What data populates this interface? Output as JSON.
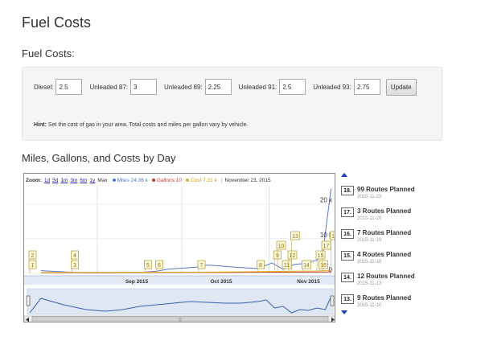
{
  "page": {
    "title": "Fuel Costs",
    "section_title": "Fuel Costs:",
    "chart_title": "Miles, Gallons, and Costs by Day"
  },
  "fuel_prices": {
    "diesel": {
      "label": "Diesel:",
      "value": "2.5"
    },
    "unleaded87": {
      "label": "Unleaded 87:",
      "value": "3"
    },
    "unleaded89": {
      "label": "Unleaded 89:",
      "value": "2.25"
    },
    "unleaded91": {
      "label": "Unleaded 91:",
      "value": "2.5"
    },
    "unleaded93": {
      "label": "Unleaded 93:",
      "value": "2.75"
    },
    "update_label": "Update"
  },
  "hint": {
    "label": "Hint:",
    "text": "Set the cost of gas in your area. Total costs and miles per gallon vary by vehicle."
  },
  "zoom": {
    "label": "Zoom:",
    "buttons": [
      "1d",
      "5d",
      "1m",
      "3m",
      "6m",
      "1y"
    ],
    "max_label": "Max"
  },
  "legend": {
    "miles": "Miles 24.36 k",
    "gallons": "Gallons 10",
    "cost": "Cost 7.31 k",
    "date": "November 23, 2015"
  },
  "colors": {
    "miles": "#5577cc",
    "gallons": "#c0392b",
    "cost": "#e0b020",
    "flag_fill": "#fffbe0",
    "flag_border": "#b8a440",
    "navigator_band": "#dfe7f5",
    "accent": "#1a3ec0"
  },
  "chart_data": {
    "type": "line",
    "x_tick_labels": [
      "Sep 2015",
      "Oct 2015",
      "Nov 2015"
    ],
    "y_tick_labels": [
      "0",
      "10 k",
      "20 k"
    ],
    "ylim": [
      0,
      25000
    ],
    "series": [
      {
        "name": "Miles",
        "x": [
          "2015-08-12",
          "2015-08-16",
          "2015-08-24",
          "2015-08-28",
          "2015-09-05",
          "2015-09-16",
          "2015-09-22",
          "2015-09-26",
          "2015-10-06",
          "2015-10-10",
          "2015-10-14",
          "2015-10-18",
          "2015-10-24",
          "2015-10-28",
          "2015-11-02",
          "2015-11-06",
          "2015-11-10",
          "2015-11-13",
          "2015-11-18",
          "2015-11-20",
          "2015-11-23"
        ],
        "y": [
          800,
          600,
          300,
          200,
          200,
          300,
          600,
          1200,
          1800,
          2400,
          2200,
          1900,
          1600,
          1400,
          3000,
          1200,
          2600,
          2800,
          3800,
          5200,
          24360
        ]
      },
      {
        "name": "Gallons",
        "x": [
          "2015-08-12",
          "2015-10-15",
          "2015-11-23"
        ],
        "y": [
          200,
          300,
          400
        ]
      },
      {
        "name": "Cost",
        "x": [
          "2015-08-12",
          "2015-10-15",
          "2015-11-18",
          "2015-11-23"
        ],
        "y": [
          300,
          400,
          700,
          900
        ]
      }
    ],
    "flags": [
      {
        "label": "2",
        "date": "2015-08-08",
        "level": 2
      },
      {
        "label": "1",
        "date": "2015-08-08",
        "level": 1
      },
      {
        "label": "4",
        "date": "2015-08-23",
        "level": 2
      },
      {
        "label": "3",
        "date": "2015-08-23",
        "level": 1
      },
      {
        "label": "5",
        "date": "2015-09-18",
        "level": 1
      },
      {
        "label": "6",
        "date": "2015-09-22",
        "level": 1
      },
      {
        "label": "7",
        "date": "2015-10-07",
        "level": 1
      },
      {
        "label": "8",
        "date": "2015-10-28",
        "level": 1
      },
      {
        "label": "9",
        "date": "2015-11-03",
        "level": 2
      },
      {
        "label": "10",
        "date": "2015-11-04",
        "level": 3
      },
      {
        "label": "11",
        "date": "2015-11-06",
        "level": 1
      },
      {
        "label": "12",
        "date": "2015-11-08",
        "level": 2
      },
      {
        "label": "13",
        "date": "2015-11-09",
        "level": 4
      },
      {
        "label": "14",
        "date": "2015-11-13",
        "level": 1
      },
      {
        "label": "15",
        "date": "2015-11-18",
        "level": 2
      },
      {
        "label": "16",
        "date": "2015-11-19",
        "level": 1
      },
      {
        "label": "17",
        "date": "2015-11-20",
        "level": 3
      },
      {
        "label": "18",
        "date": "2015-11-23",
        "level": 4
      }
    ],
    "navigator": {
      "x": [
        "2015-08-08",
        "2015-08-12",
        "2015-08-20",
        "2015-08-28",
        "2015-09-04",
        "2015-09-10",
        "2015-09-16",
        "2015-09-22",
        "2015-09-28",
        "2015-10-04",
        "2015-10-10",
        "2015-10-16",
        "2015-10-22",
        "2015-10-28",
        "2015-10-31",
        "2015-11-03",
        "2015-11-06",
        "2015-11-09",
        "2015-11-12",
        "2015-11-15",
        "2015-11-18",
        "2015-11-21",
        "2015-11-23"
      ],
      "y": [
        30,
        12,
        20,
        26,
        28,
        26,
        22,
        20,
        18,
        16,
        17,
        18,
        18,
        16,
        14,
        24,
        22,
        30,
        26,
        27,
        24,
        26,
        10
      ]
    }
  },
  "routes": [
    {
      "num": "18.",
      "title": "99 Routes Planned",
      "date": "2015-11-23"
    },
    {
      "num": "17.",
      "title": "3 Routes Planned",
      "date": "2015-11-20"
    },
    {
      "num": "16.",
      "title": "7 Routes Planned",
      "date": "2015-11-19"
    },
    {
      "num": "15.",
      "title": "4 Routes Planned",
      "date": "2015-11-18"
    },
    {
      "num": "14.",
      "title": "12 Routes Planned",
      "date": "2015-11-13"
    },
    {
      "num": "13.",
      "title": "9 Routes Planned",
      "date": "2015-11-10"
    }
  ]
}
